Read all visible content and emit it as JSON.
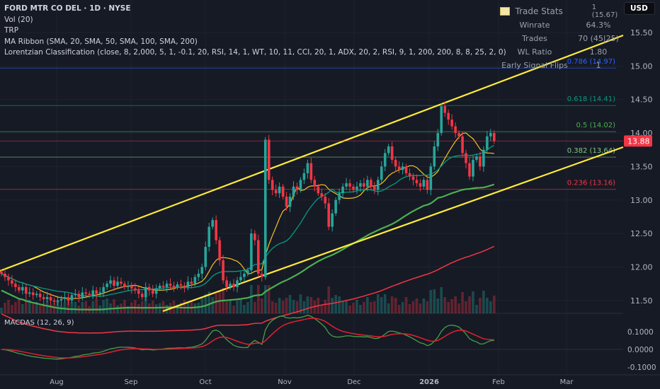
{
  "legend": {
    "title": "FORD MTR CO DEL · 1D · NYSE",
    "indicators": [
      "Vol (20)",
      "TRP",
      "MA Ribbon (SMA, 20, SMA, 50, SMA, 100, SMA, 200)",
      "Lorentzian Classification (close, 8, 2,000, 5, 1, -0.1, 20, RSI, 14, 1, WT, 10, 11, CCI, 20, 1, ADX, 20, 2, RSI, 9, 1, 200, 200, 8, 8, 25, 2, 0)"
    ]
  },
  "trade_stats": {
    "title": "Trade Stats",
    "header_value": "1 (15.67)",
    "rows": [
      {
        "label": "Winrate",
        "value": "64.3%"
      },
      {
        "label": "Trades",
        "value": "70 (45|25)"
      },
      {
        "label": "WL Ratio",
        "value": "1.80"
      },
      {
        "label": "Early Signal Flips",
        "value": "1"
      }
    ]
  },
  "currency": "USD",
  "colors": {
    "up": "#26a69a",
    "down": "#f23645",
    "trendline": "#ffeb3b",
    "sma20": "#089981",
    "sma50": "#4caf50",
    "sma100": "#f23645",
    "macd": "#43a047",
    "signal": "#e5202f"
  },
  "chart_data": [
    {
      "type": "candlestick",
      "title": "FORD MTR CO DEL · 1D · NYSE",
      "ylim": [
        11.35,
        15.6
      ],
      "y_ticks": [
        "15.50",
        "15.00",
        "14.50",
        "14.00",
        "13.50",
        "13.00",
        "12.50",
        "12.00",
        "11.50"
      ],
      "x_ticks": [
        "Aug",
        "Sep",
        "Oct",
        "Nov",
        "Dec",
        "2026",
        "Feb",
        "Mar"
      ],
      "last_price": "13.88",
      "closes": [
        11.9,
        11.85,
        11.8,
        11.75,
        11.7,
        11.65,
        11.7,
        11.6,
        11.62,
        11.58,
        11.6,
        11.55,
        11.52,
        11.55,
        11.5,
        11.48,
        11.5,
        11.52,
        11.55,
        11.5,
        11.58,
        11.6,
        11.55,
        11.62,
        11.6,
        11.58,
        11.65,
        11.6,
        11.62,
        11.7,
        11.75,
        11.8,
        11.72,
        11.78,
        11.75,
        11.7,
        11.72,
        11.68,
        11.65,
        11.6,
        11.55,
        11.7,
        11.65,
        11.6,
        11.68,
        11.72,
        11.7,
        11.75,
        11.72,
        11.7,
        11.74,
        11.72,
        11.7,
        11.78,
        11.75,
        11.85,
        11.9,
        12.0,
        12.3,
        12.6,
        12.7,
        12.4,
        12.1,
        11.8,
        11.7,
        11.75,
        11.7,
        11.8,
        11.85,
        11.9,
        11.95,
        12.5,
        12.4,
        11.9,
        11.85,
        13.9,
        13.3,
        13.15,
        13.1,
        13.2,
        13.05,
        12.9,
        13.05,
        13.2,
        13.15,
        13.3,
        13.4,
        13.55,
        13.3,
        13.2,
        13.1,
        13.05,
        12.95,
        12.6,
        12.8,
        13.0,
        13.1,
        13.2,
        13.25,
        13.2,
        13.15,
        13.2,
        13.25,
        13.2,
        13.3,
        13.2,
        13.15,
        13.3,
        13.5,
        13.7,
        13.8,
        13.6,
        13.5,
        13.45,
        13.5,
        13.4,
        13.35,
        13.3,
        13.25,
        13.2,
        13.3,
        13.15,
        13.5,
        13.8,
        14.0,
        14.4,
        14.3,
        14.2,
        14.1,
        14.0,
        13.95,
        13.7,
        13.55,
        13.35,
        13.6,
        13.65,
        13.5,
        13.75,
        13.95,
        14.0,
        13.88
      ],
      "fib_levels": [
        {
          "label": "0.786 (14.97)",
          "price": 14.97,
          "color": "#2962ff"
        },
        {
          "label": "0.618 (14.41)",
          "price": 14.41,
          "color": "#089981"
        },
        {
          "label": "0.5 (14.02)",
          "price": 14.02,
          "color": "#4caf50"
        },
        {
          "label": "0.382 (13.64)",
          "price": 13.64,
          "color": "#81c784"
        },
        {
          "label": "0.236 (13.16)",
          "price": 13.16,
          "color": "#f23645"
        }
      ]
    },
    {
      "type": "line",
      "title": "MACDAS (12, 26, 9)",
      "ylim": [
        -0.15,
        0.17
      ],
      "y_ticks": [
        "0.1000",
        "0.0000",
        "-0.1000"
      ]
    }
  ]
}
